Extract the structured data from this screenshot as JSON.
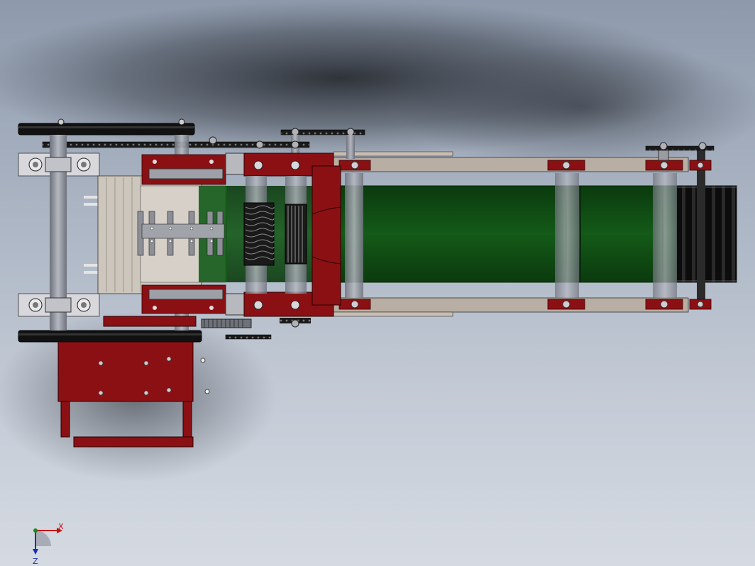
{
  "viewport": {
    "background_top": "#8e9aac",
    "background_bottom": "#d5dae2"
  },
  "colors": {
    "frame_red": "#8b1014",
    "belt_green": "#0f4a12",
    "shaft_gray": "#8d9099",
    "chain_black": "#151515",
    "tan_rail": "#b8ada3",
    "bearing_light": "#d6d6da"
  },
  "triad": {
    "x_label": "X",
    "z_label": "Z"
  }
}
